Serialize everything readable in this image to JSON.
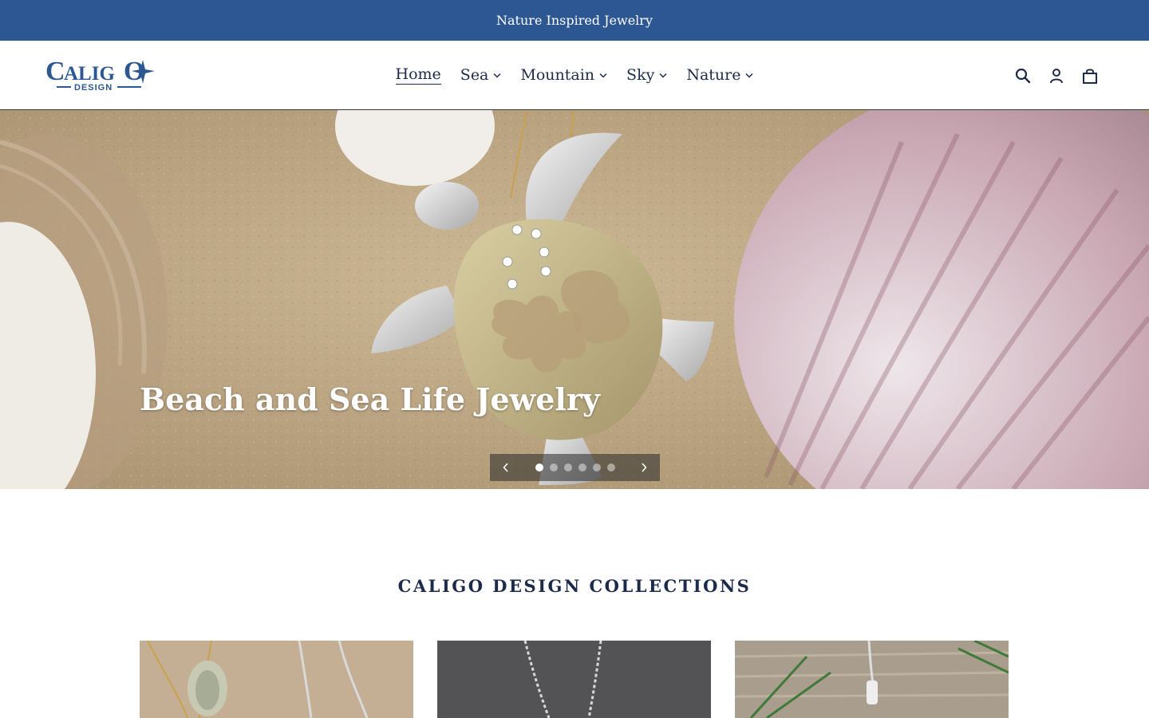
{
  "announcement": {
    "text": "Nature Inspired Jewelry"
  },
  "brand": {
    "name": "CALIGO",
    "tagline": "DESIGN",
    "color": "#2c5793"
  },
  "nav": {
    "items": [
      {
        "label": "Home",
        "active": true,
        "dropdown": false
      },
      {
        "label": "Sea",
        "active": false,
        "dropdown": true
      },
      {
        "label": "Mountain",
        "active": false,
        "dropdown": true
      },
      {
        "label": "Sky",
        "active": false,
        "dropdown": true
      },
      {
        "label": "Nature",
        "active": false,
        "dropdown": true
      }
    ]
  },
  "header_icons": [
    "search-icon",
    "account-icon",
    "cart-icon"
  ],
  "hero": {
    "heading": "Beach and Sea Life Jewelry",
    "slide_count": 6,
    "active_slide": 1,
    "prev_icon": "chevron-left-icon",
    "next_icon": "chevron-right-icon"
  },
  "collections": {
    "title": "CALIGO DESIGN COLLECTIONS"
  },
  "colors": {
    "announcement_bg": "#2c5793",
    "nav_text": "#1c2b4a"
  }
}
